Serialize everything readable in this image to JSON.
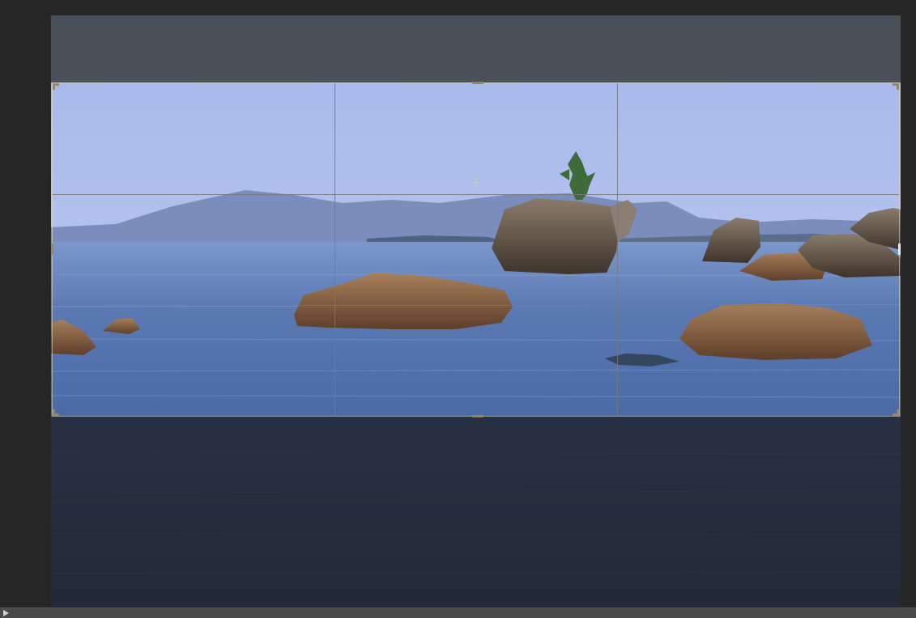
{
  "app": {
    "mode": "crop"
  },
  "icons": {
    "crosshair": "crosshair-icon",
    "status_arrow": "triangle-right-icon"
  },
  "colors": {
    "workspace_bg": "#262626",
    "crop_handle": "#9c8556",
    "grid_line": "#787878",
    "status_bar": "#4a4a4a"
  },
  "crop": {
    "grid": "rule-of-thirds"
  }
}
